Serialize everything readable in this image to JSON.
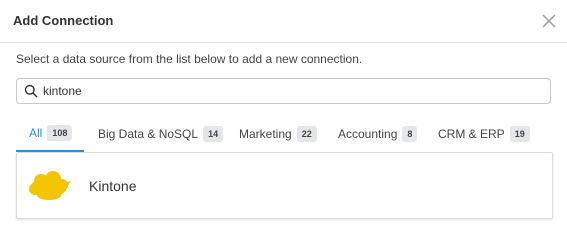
{
  "dialog": {
    "title": "Add Connection",
    "subtitle": "Select a data source from the list below to add a new connection."
  },
  "search": {
    "value": "kintone",
    "icon": "search-icon"
  },
  "tabs": [
    {
      "label": "All",
      "count": "108",
      "active": true
    },
    {
      "label": "Big Data & NoSQL",
      "count": "14",
      "active": false
    },
    {
      "label": "Marketing",
      "count": "22",
      "active": false
    },
    {
      "label": "Accounting",
      "count": "8",
      "active": false
    },
    {
      "label": "CRM & ERP",
      "count": "19",
      "active": false
    }
  ],
  "results": [
    {
      "name": "Kintone",
      "icon": "kintone-cloud-icon",
      "icon_color": "#f5c400"
    }
  ],
  "colors": {
    "accent": "#2b8fd6",
    "badge_bg": "#e4e6ea",
    "border": "#e3e3e3"
  }
}
